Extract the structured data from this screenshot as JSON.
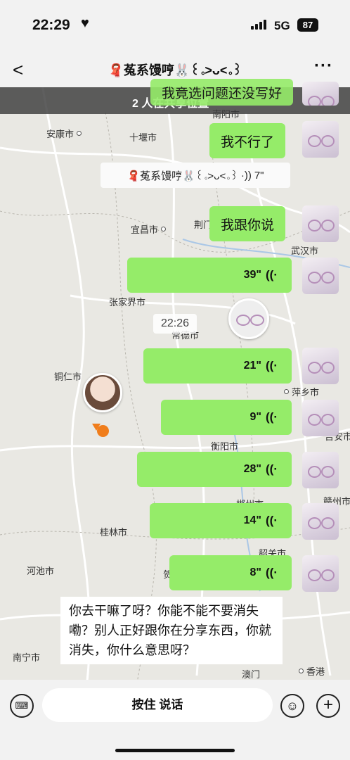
{
  "status_bar": {
    "time": "22:29",
    "heart": "♥",
    "network": "5G",
    "battery": "87"
  },
  "nav": {
    "back": "<",
    "title": "🧣菟系馒哼🐰꒰｡>ᴗ<｡꒱",
    "more": "···"
  },
  "banner": {
    "text": "2 人在共享位置"
  },
  "map": {
    "cities": [
      {
        "name": "南阳市"
      },
      {
        "name": "安康市"
      },
      {
        "name": "十堰市"
      },
      {
        "name": "宜昌市"
      },
      {
        "name": "荆门"
      },
      {
        "name": "武汉市"
      },
      {
        "name": "张家界市"
      },
      {
        "name": "常德市"
      },
      {
        "name": "铜仁市"
      },
      {
        "name": "萍乡市"
      },
      {
        "name": "衡阳市"
      },
      {
        "name": "吉安市"
      },
      {
        "name": "赣州市"
      },
      {
        "name": "郴州市"
      },
      {
        "name": "桂林市"
      },
      {
        "name": "韶关市"
      },
      {
        "name": "河池市"
      },
      {
        "name": "贺州"
      },
      {
        "name": "南宁市"
      },
      {
        "name": "澳门"
      },
      {
        "name": "香港"
      }
    ]
  },
  "messages": {
    "top_partial": "我竟选问题还没写好",
    "m1": "我不行了",
    "voice_notice": {
      "sender": "🧣菟系馒哼🐰꒰｡>ᴗ<｡꒱",
      "icon": "·))",
      "duration": "7\""
    },
    "m2": "我跟你说",
    "timestamp": "22:26",
    "voices": [
      {
        "duration": "39\""
      },
      {
        "duration": "21\""
      },
      {
        "duration": "9\""
      },
      {
        "duration": "28\""
      },
      {
        "duration": "14\""
      },
      {
        "duration": "8\""
      }
    ],
    "wave_glyph": "((·"
  },
  "caption": "你去干嘛了呀？你能不能不要消失嘞？别人正好跟你在分享东西，你就消失，你什么意思呀？",
  "bottom": {
    "keyboard_icon": "⌨",
    "talk_label": "按住 说话",
    "emoji_icon": "☺",
    "plus_icon": "+"
  }
}
